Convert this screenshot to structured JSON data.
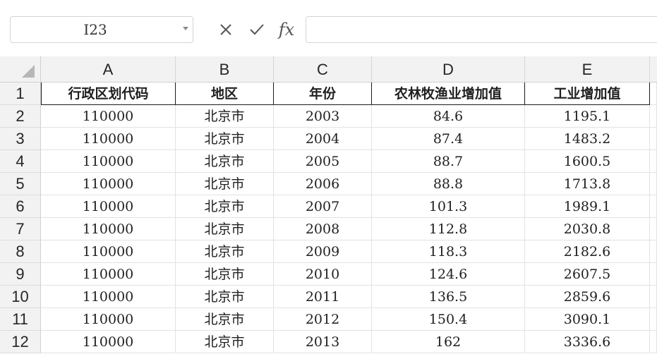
{
  "name_box": {
    "value": "I23"
  },
  "formula_bar": {
    "cancel_icon": "✕",
    "confirm_icon": "✓",
    "fx_label": "fx",
    "value": ""
  },
  "columns": [
    "A",
    "B",
    "C",
    "D",
    "E"
  ],
  "row_numbers": [
    "1",
    "2",
    "3",
    "4",
    "5",
    "6",
    "7",
    "8",
    "9",
    "10",
    "11",
    "12"
  ],
  "header_row": [
    "行政区划代码",
    "地区",
    "年份",
    "农林牧渔业增加值",
    "工业增加值"
  ],
  "rows": [
    [
      "110000",
      "北京市",
      "2003",
      "84.6",
      "1195.1"
    ],
    [
      "110000",
      "北京市",
      "2004",
      "87.4",
      "1483.2"
    ],
    [
      "110000",
      "北京市",
      "2005",
      "88.7",
      "1600.5"
    ],
    [
      "110000",
      "北京市",
      "2006",
      "88.8",
      "1713.8"
    ],
    [
      "110000",
      "北京市",
      "2007",
      "101.3",
      "1989.1"
    ],
    [
      "110000",
      "北京市",
      "2008",
      "112.8",
      "2030.8"
    ],
    [
      "110000",
      "北京市",
      "2009",
      "118.3",
      "2182.6"
    ],
    [
      "110000",
      "北京市",
      "2010",
      "124.6",
      "2607.5"
    ],
    [
      "110000",
      "北京市",
      "2011",
      "136.5",
      "2859.6"
    ],
    [
      "110000",
      "北京市",
      "2012",
      "150.4",
      "3090.1"
    ],
    [
      "110000",
      "北京市",
      "2013",
      "162",
      "3336.6"
    ]
  ]
}
